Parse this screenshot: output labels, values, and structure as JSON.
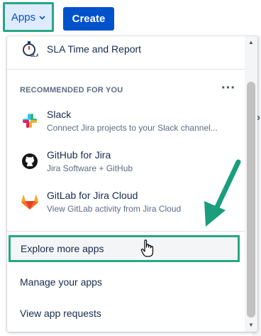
{
  "topbar": {
    "apps_label": "Apps",
    "create_label": "Create"
  },
  "dropdown": {
    "pinned_item": {
      "title": "SLA Time and Report",
      "icon": "sla-stopwatch-icon"
    },
    "recommended_header": "RECOMMENDED FOR YOU",
    "recommended": [
      {
        "title": "Slack",
        "subtitle": "Connect Jira projects to your Slack channel...",
        "icon": "slack-icon"
      },
      {
        "title": "GitHub for Jira",
        "subtitle": "Jira Software + GitHub",
        "icon": "github-icon"
      },
      {
        "title": "GitLab for Jira Cloud",
        "subtitle": "View GitLab activity from Jira Cloud",
        "icon": "gitlab-icon"
      }
    ],
    "explore_label": "Explore more apps",
    "manage_label": "Manage your apps",
    "requests_label": "View app requests"
  },
  "colors": {
    "highlight": "#26a882",
    "brand_blue": "#0052cc",
    "arrow": "#1a9e7e"
  }
}
